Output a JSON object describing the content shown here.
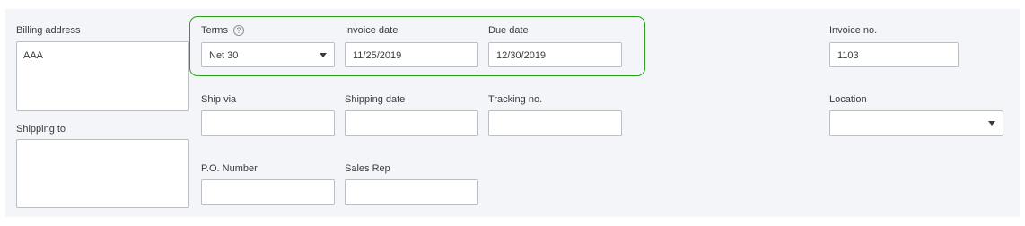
{
  "billing": {
    "label": "Billing address",
    "value": "AAA"
  },
  "shipping_to": {
    "label": "Shipping to",
    "value": ""
  },
  "terms": {
    "label": "Terms",
    "help_icon": "question-circle-icon",
    "help_glyph": "?",
    "value": "Net 30"
  },
  "invoice_date": {
    "label": "Invoice date",
    "value": "11/25/2019"
  },
  "due_date": {
    "label": "Due date",
    "value": "12/30/2019"
  },
  "invoice_no": {
    "label": "Invoice no.",
    "value": "1103"
  },
  "ship_via": {
    "label": "Ship via",
    "value": ""
  },
  "shipping_date": {
    "label": "Shipping date",
    "value": ""
  },
  "tracking_no": {
    "label": "Tracking no.",
    "value": ""
  },
  "location": {
    "label": "Location",
    "value": ""
  },
  "po_number": {
    "label": "P.O. Number",
    "value": ""
  },
  "sales_rep": {
    "label": "Sales Rep",
    "value": ""
  },
  "colors": {
    "panel_bg": "#f4f5f8",
    "highlight": "#2ca01c",
    "field_border": "#babec5"
  }
}
